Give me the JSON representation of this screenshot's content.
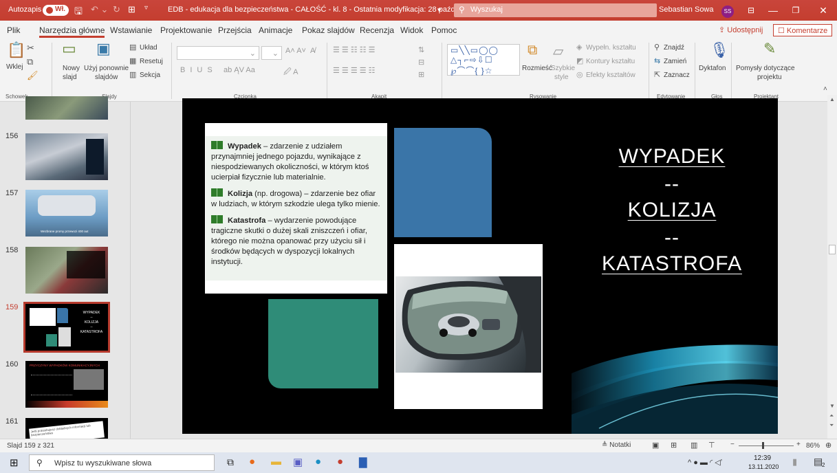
{
  "titlebar": {
    "autosave": "Autozapis",
    "autosave_state": "Wł.",
    "doc_title": "EDB - edukacja dla bezpieczeństwa - CAŁOŚĆ - kl. 8  -  Ostatnia modyfikacja: 28 października",
    "search_placeholder": "Wyszukaj",
    "user_name": "Sebastian Sowa",
    "user_initials": "SS",
    "bg_color": "#c43e2f"
  },
  "menu": {
    "tabs": [
      "Plik",
      "Narzędzia główne",
      "Wstawianie",
      "Projektowanie",
      "Przejścia",
      "Animacje",
      "Pokaz slajdów",
      "Recenzja",
      "Widok",
      "Pomoc"
    ],
    "share": "Udostępnij",
    "comments": "Komentarze"
  },
  "ribbon": {
    "clipboard": {
      "paste": "Wklej",
      "group": "Schowek"
    },
    "slides": {
      "new_slide_1": "Nowy",
      "new_slide_2": "slajd",
      "reuse_1": "Użyj ponownie",
      "reuse_2": "slajdów",
      "layout": "Układ",
      "reset": "Resetuj",
      "section": "Sekcja",
      "group": "Slajdy"
    },
    "font": {
      "group": "Czcionka"
    },
    "paragraph": {
      "group": "Akapit"
    },
    "drawing": {
      "arrange": "Rozmieść",
      "quick_styles_1": "Szybkie",
      "quick_styles_2": "style",
      "fill": "Wypełn. kształtu",
      "outline": "Kontury kształtu",
      "effects": "Efekty kształtów",
      "group": "Rysowanie"
    },
    "editing": {
      "find": "Znajdź",
      "replace": "Zamień",
      "select": "Zaznacz",
      "group": "Edytowanie"
    },
    "voice": {
      "dictate": "Dyktafon",
      "group": "Głos"
    },
    "designer": {
      "ideas_1": "Pomysły dotyczące",
      "ideas_2": "projektu",
      "group": "Projektant"
    }
  },
  "slides_panel": {
    "numbers": [
      "156",
      "157",
      "158",
      "159",
      "160",
      "161"
    ],
    "selected": "159",
    "thumb157_caption": "Wezbrane promy przewozi 400 aut",
    "thumb159_lines": [
      "WYPADEK",
      "--",
      "KOLIZJA",
      "--",
      "KATASTROFA"
    ],
    "thumb160_title": "PRZYCZYNY WYPADKÓW KOMUNIKACYJNYCH",
    "thumb161_text": "Jeśli potrzebujesz dokładnych informacji lub bezpieczeństwa"
  },
  "slide": {
    "definitions": [
      {
        "term": "Wypadek",
        "text": " – zdarzenie z udziałem przynajmniej jednego pojazdu, wynikające z niespodziewanych okoliczności, w którym ktoś ucierpiał fizycznie lub materialnie."
      },
      {
        "term": "Kolizja",
        "text": " (np. drogowa) – zdarzenie bez ofiar w ludziach, w którym szkodzie ulega tylko mienie."
      },
      {
        "term": "Katastrofa",
        "text": " – wydarzenie powodujące tragiczne skutki o dużej skali zniszczeń i ofiar, którego nie można opanować przy użyciu sił i środków będących w dyspozycji lokalnych instytucji."
      }
    ],
    "title_lines": [
      "WYPADEK",
      "--",
      "KOLIZJA",
      "--",
      "KATASTROFA"
    ],
    "blue": "#3a75a8",
    "teal": "#2f8c78"
  },
  "status": {
    "slide_count": "Slajd 159 z 321",
    "notes": "Notatki",
    "zoom": "86%"
  },
  "taskbar": {
    "search_placeholder": "Wpisz tu wyszukiwane słowa",
    "time": "12:39",
    "date": "13.11.2020",
    "notification_count": "2"
  }
}
